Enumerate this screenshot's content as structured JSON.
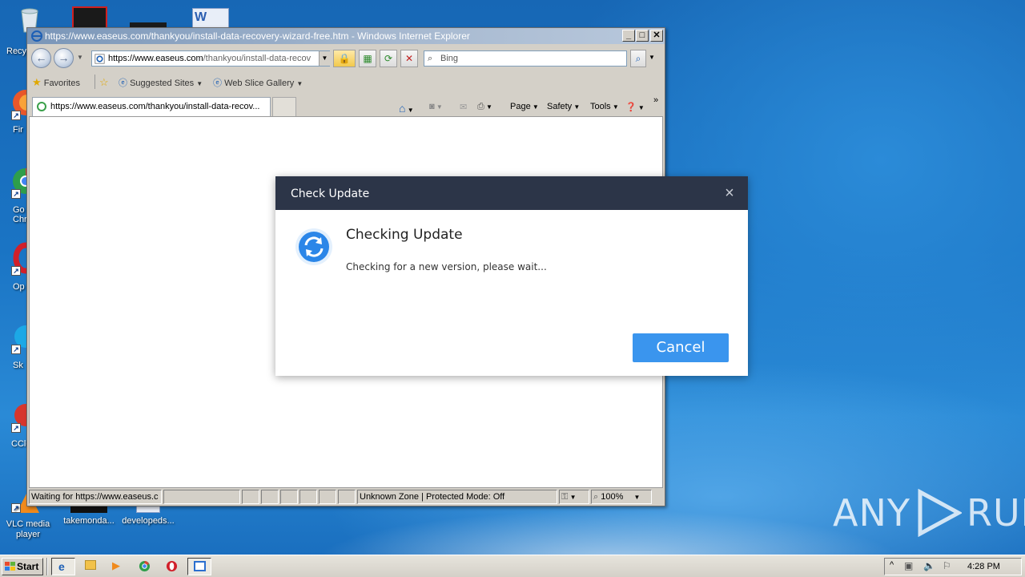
{
  "desktop": {
    "icons": [
      {
        "label": "Recy"
      },
      {
        "label": "VLC media player"
      },
      {
        "label": "takemonda..."
      },
      {
        "label": "developeds..."
      }
    ],
    "left_labels": [
      "Fir",
      "Go Chr",
      "Op",
      "Sk",
      "CCle"
    ]
  },
  "ie": {
    "title": "https://www.easeus.com/thankyou/install-data-recovery-wizard-free.htm - Windows Internet Explorer",
    "address_prefix": "https://www.easeus.com",
    "address_rest": "/thankyou/install-data-recov",
    "search_placeholder": "Bing",
    "favorites_label": "Favorites",
    "suggested_sites": "Suggested Sites",
    "web_slice_gallery": "Web Slice Gallery",
    "tab_title": "https://www.easeus.com/thankyou/install-data-recov...",
    "commands": {
      "page": "Page",
      "safety": "Safety",
      "tools": "Tools"
    },
    "status": {
      "text": "Waiting for https://www.easeus.c",
      "zone": "Unknown Zone | Protected Mode: Off",
      "zoom": "100%"
    }
  },
  "dialog": {
    "header": "Check Update",
    "title": "Checking Update",
    "message": "Checking for a new version, please wait...",
    "cancel_label": "Cancel"
  },
  "taskbar": {
    "start_label": "Start",
    "clock": "4:28 PM"
  },
  "watermark": {
    "left": "ANY",
    "right": "RUN"
  },
  "colors": {
    "dialog_header": "#2c3548",
    "cancel_button": "#3a95ee",
    "desktop": "#1669b6"
  }
}
